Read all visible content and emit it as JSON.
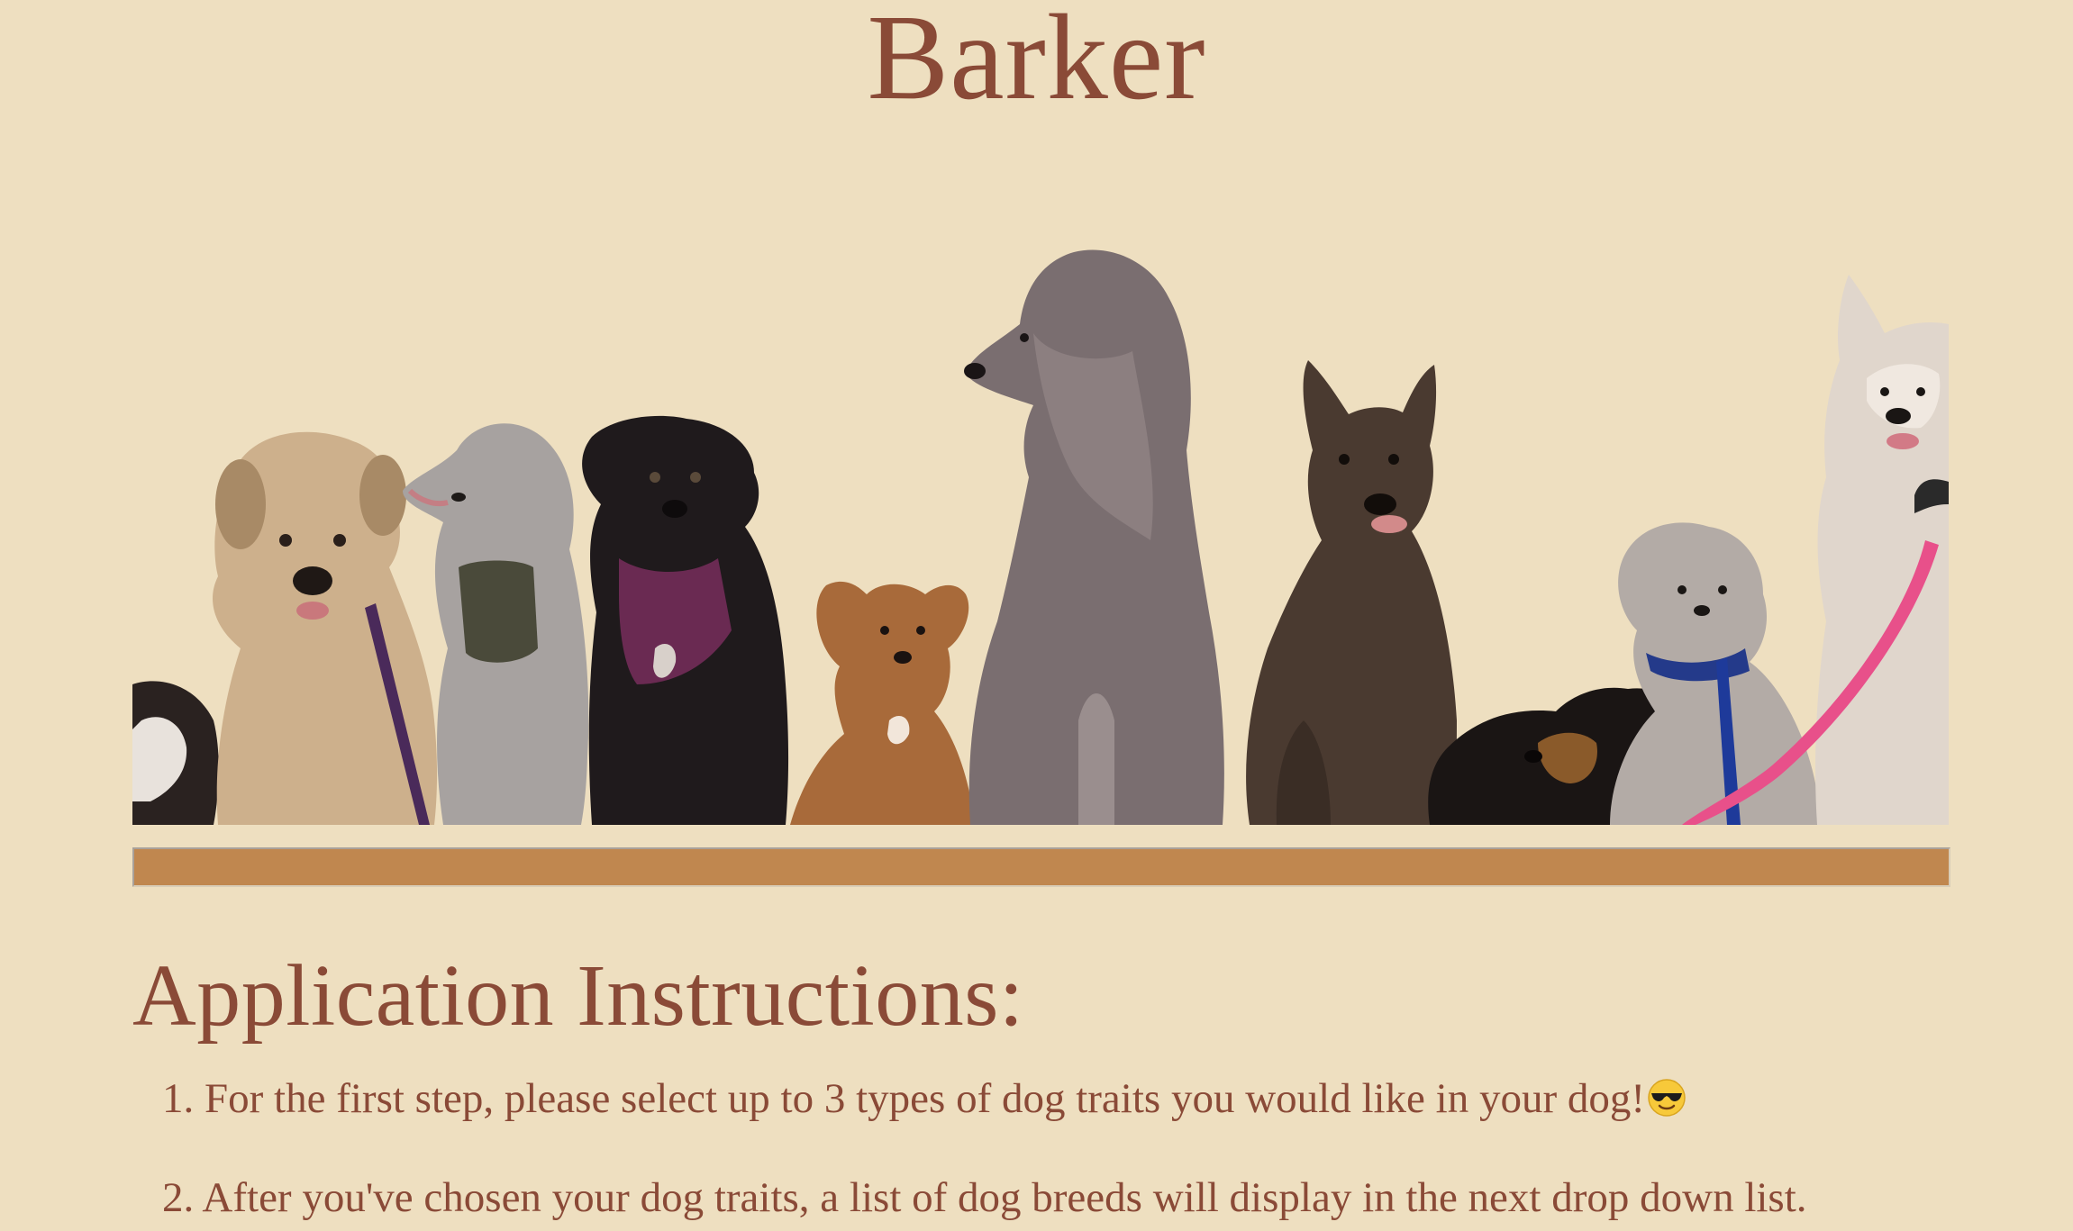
{
  "site": {
    "title": "Barker"
  },
  "hero": {
    "image_name": "dog-lineup-photo",
    "dogs": [
      {
        "name": "dog-partial-left"
      },
      {
        "name": "dog-wheaten-terrier"
      },
      {
        "name": "dog-grey-poodle-small"
      },
      {
        "name": "dog-black-lab"
      },
      {
        "name": "dog-brown-mix"
      },
      {
        "name": "dog-standard-poodle"
      },
      {
        "name": "dog-brindle-shepherd"
      },
      {
        "name": "dog-black-dachshund"
      },
      {
        "name": "dog-shih-tzu"
      },
      {
        "name": "dog-husky-white"
      }
    ]
  },
  "divider": {
    "color": "#C0874F"
  },
  "instructions": {
    "heading": "Application Instructions:",
    "steps": [
      {
        "number": "1.",
        "text": "For the first step, please select up to 3 types of dog traits you would like in your dog!",
        "icon": "sunglasses-emoji-icon"
      },
      {
        "number": "2.",
        "text": "After you've chosen your dog traits, a list of dog breeds will display in the next drop down list."
      }
    ]
  },
  "colors": {
    "background": "#EEDFC0",
    "text": "#8A4A37",
    "accent_bar": "#C0874F"
  }
}
